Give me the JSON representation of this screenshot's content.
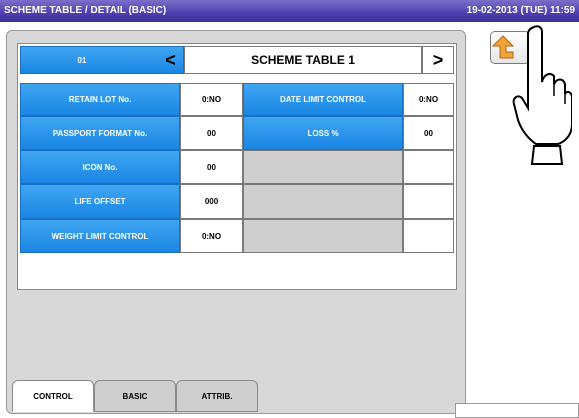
{
  "header": {
    "title": "SCHEME TABLE / DETAIL (BASIC)",
    "datetime": "19-02-2013 (TUE) 11:59"
  },
  "selector": {
    "number": "01",
    "prev": "<",
    "title": "SCHEME TABLE 1",
    "next": ">"
  },
  "rows": [
    {
      "label": "RETAIN LOT No.",
      "value": "0:NO",
      "label2": "DATE LIMIT CONTROL",
      "value2": "0:NO"
    },
    {
      "label": "PASSPORT FORMAT No.",
      "value": "00",
      "label2": "LOSS %",
      "value2": "00"
    },
    {
      "label": "ICON No.",
      "value": "00"
    },
    {
      "label": "LIFE OFFSET",
      "value": "000"
    },
    {
      "label": "WEIGHT LIMIT CONTROL",
      "value": "0:NO"
    }
  ],
  "tabs": [
    {
      "label": "CONTROL",
      "active": true
    },
    {
      "label": "BASIC",
      "active": false
    },
    {
      "label": "ATTRIB.",
      "active": false
    }
  ],
  "colors": {
    "accent": "#1a86e4",
    "title_bar": "#4d3fb0",
    "return_arrow": "#f2a23a"
  },
  "icons": {
    "back": "return-arrow-icon",
    "hand": "pointing-hand-icon"
  }
}
